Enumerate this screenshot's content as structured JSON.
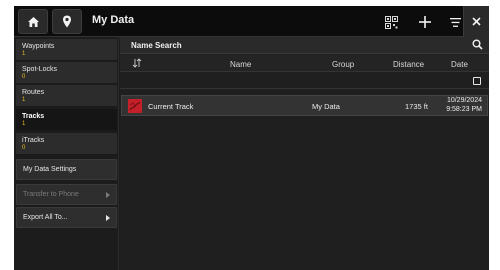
{
  "header": {
    "title": "My Data",
    "icons": [
      "home-icon",
      "map-pin-icon",
      "qr-code-icon",
      "plus-icon",
      "menu-icon",
      "close-icon"
    ]
  },
  "sidebar": {
    "items": [
      {
        "label": "Waypoints",
        "count": "1"
      },
      {
        "label": "Spot-Locks",
        "count": "0"
      },
      {
        "label": "Routes",
        "count": "1"
      },
      {
        "label": "Tracks",
        "count": "1"
      },
      {
        "label": "iTracks",
        "count": "0"
      }
    ],
    "buttons": {
      "settings": "My Data Settings",
      "transfer": "Transfer to Phone",
      "export": "Export All To..."
    }
  },
  "main": {
    "search_label": "Name Search",
    "columns": {
      "name": "Name",
      "group": "Group",
      "distance": "Distance",
      "date": "Date"
    },
    "rows": [
      {
        "name": "Current Track",
        "group": "My Data",
        "distance": "1735 ft",
        "date_line1": "10/29/2024",
        "date_line2": "9:58:23 PM"
      }
    ]
  },
  "colors": {
    "count_accent": "#e8c020",
    "track_red": "#c4202a"
  }
}
